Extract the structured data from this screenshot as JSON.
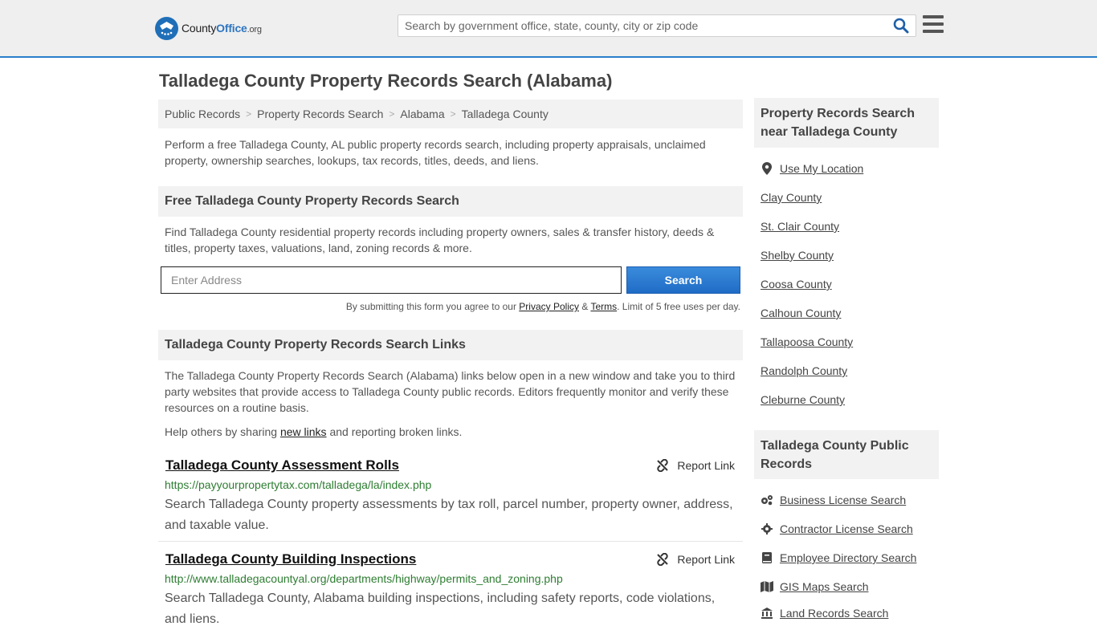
{
  "header": {
    "logo_main": "County",
    "logo_brand": "Office",
    "logo_tld": ".org",
    "search_placeholder": "Search by government office, state, county, city or zip code"
  },
  "page": {
    "title": "Talladega County Property Records Search (Alabama)",
    "breadcrumb": [
      "Public Records",
      "Property Records Search",
      "Alabama",
      "Talladega County"
    ],
    "intro": "Perform a free Talladega County, AL public property records search, including property appraisals, unclaimed property, ownership searches, lookups, tax records, titles, deeds, and liens."
  },
  "free_search": {
    "heading": "Free Talladega County Property Records Search",
    "description": "Find Talladega County residential property records including property owners, sales & transfer history, deeds & titles, property taxes, valuations, land, zoning records & more.",
    "address_placeholder": "Enter Address",
    "button_label": "Search",
    "disclaimer_pre": "By submitting this form you agree to our",
    "privacy_label": "Privacy Policy",
    "amp": "&",
    "terms_label": "Terms",
    "disclaimer_post": ". Limit of 5 free uses per day."
  },
  "links_section": {
    "heading": "Talladega County Property Records Search Links",
    "description": "The Talladega County Property Records Search (Alabama) links below open in a new window and take you to third party websites that provide access to Talladega County public records. Editors frequently monitor and verify these resources on a routine basis.",
    "help_pre": "Help others by sharing",
    "help_link": "new links",
    "help_post": "and reporting broken links.",
    "report_label": "Report Link",
    "items": [
      {
        "title": "Talladega County Assessment Rolls",
        "url": "https://payyourpropertytax.com/talladega/la/index.php",
        "desc": "Search Talladega County property assessments by tax roll, parcel number, property owner, address, and taxable value."
      },
      {
        "title": "Talladega County Building Inspections",
        "url": "http://www.talladegacountyal.org/departments/highway/permits_and_zoning.php",
        "desc": "Search Talladega County, Alabama building inspections, including safety reports, code violations, and liens."
      }
    ]
  },
  "sidebar": {
    "nearby_heading": "Property Records Search near Talladega County",
    "use_location": "Use My Location",
    "nearby": [
      "Clay County",
      "St. Clair County",
      "Shelby County",
      "Coosa County",
      "Calhoun County",
      "Tallapoosa County",
      "Randolph County",
      "Cleburne County"
    ],
    "public_heading": "Talladega County Public Records",
    "public_records": [
      {
        "label": "Business License Search",
        "icon": "gears-icon"
      },
      {
        "label": "Contractor License Search",
        "icon": "gear-icon"
      },
      {
        "label": "Employee Directory Search",
        "icon": "book-icon"
      },
      {
        "label": "GIS Maps Search",
        "icon": "map-icon"
      },
      {
        "label": "Land Records Search",
        "icon": "landmark-icon"
      }
    ]
  },
  "colors": {
    "accent": "#2a7ec9",
    "button": "#1f6cc6",
    "url_green": "#2e7d32",
    "header_bg": "#efefef"
  }
}
